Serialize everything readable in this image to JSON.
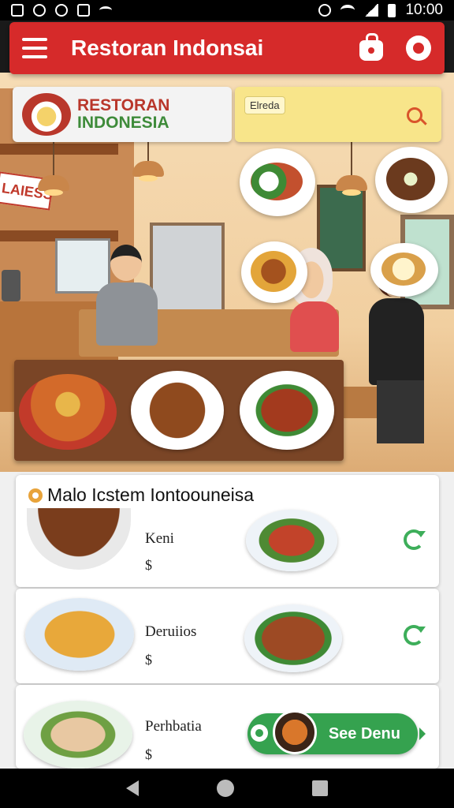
{
  "status_bar": {
    "time": "10:00"
  },
  "app_bar": {
    "title": "Restoran Indonsai",
    "icons": [
      "menu-icon",
      "shopping-bag-icon",
      "chat-icon"
    ],
    "color": "#d62a2a"
  },
  "hero": {
    "logo_line1": "RESTORAN",
    "logo_line2": "INDONESIA",
    "search_chip": "Elreda",
    "wall_sign": "LAIESS"
  },
  "menu": {
    "section_title": "Malo Icstem Iontoouneisa",
    "items": [
      {
        "name": "Keni",
        "price": "$"
      },
      {
        "name": "Deruiios",
        "price": "$"
      },
      {
        "name": "Perhbatia",
        "price": "$"
      }
    ],
    "see_menu_label": "See Denu"
  },
  "colors": {
    "accent_green": "#35a24f",
    "accent_red": "#d62a2a"
  }
}
